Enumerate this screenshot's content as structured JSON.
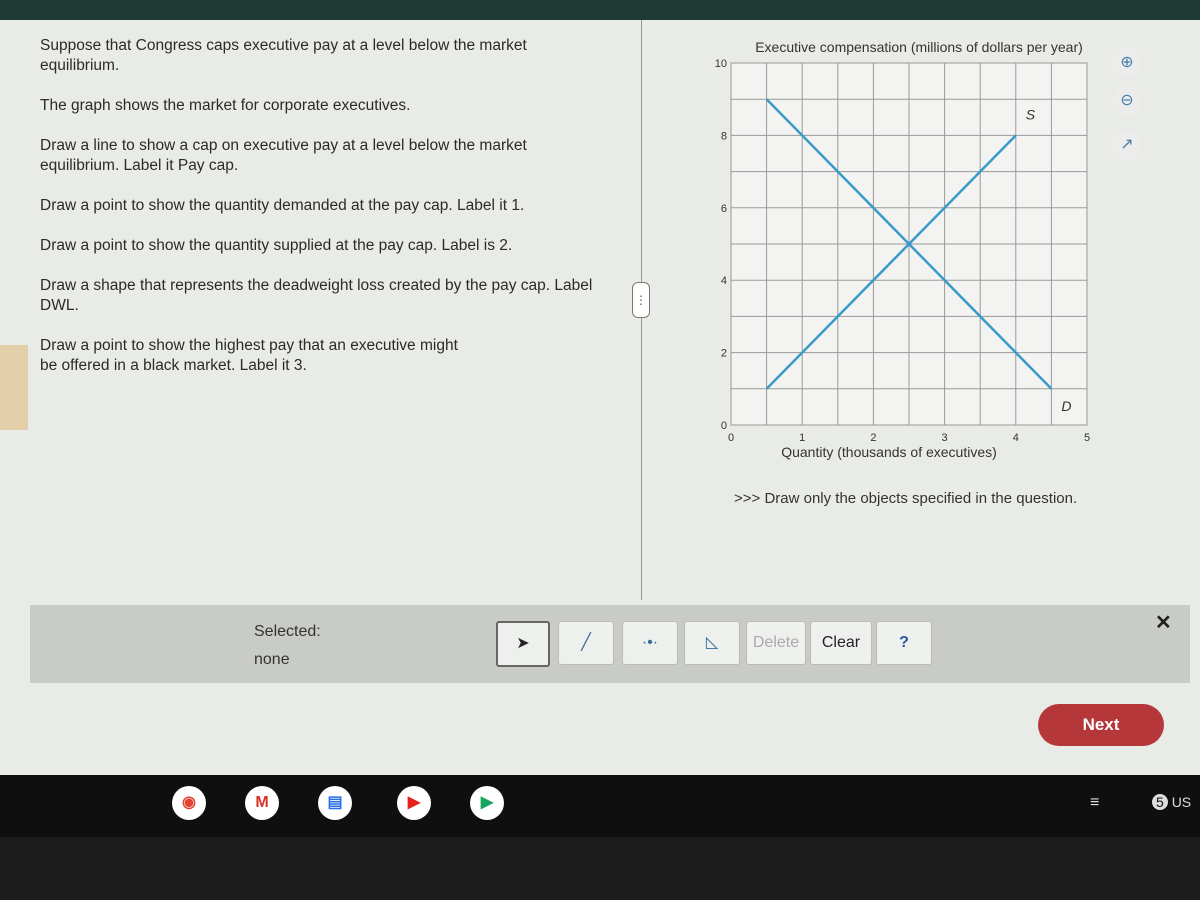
{
  "question": {
    "paragraphs": [
      "Suppose that Congress caps executive pay at a level below the market equilibrium.",
      "The graph shows the market for corporate executives.",
      "Draw a line to show a cap on executive pay at a level below the market equilibrium. Label it Pay cap.",
      "Draw a point to show the quantity demanded at the pay cap. Label it 1.",
      "Draw a point to show the quantity supplied at the pay cap. Label is 2.",
      "Draw a shape that represents the deadweight loss created by the pay cap. Label DWL.",
      "Draw a point to show the highest pay that an executive might be offered in a black market. Label it 3."
    ]
  },
  "graph_tools": {
    "zoom_in": "zoom-in-icon",
    "zoom_out": "zoom-out-icon",
    "popout": "popout-icon"
  },
  "chart_data": {
    "type": "line",
    "title": "Executive compensation (millions of dollars per year)",
    "xlabel": "Quantity (thousands of executives)",
    "ylabel": "Executive compensation (millions of dollars per year)",
    "xlim": [
      0,
      5
    ],
    "ylim": [
      0,
      10
    ],
    "xticks": [
      "0",
      "1",
      "2",
      "3",
      "4",
      "5"
    ],
    "yticks": [
      "0",
      "2",
      "4",
      "6",
      "8",
      "10"
    ],
    "grid": true,
    "series": [
      {
        "name": "S",
        "points": [
          [
            0.5,
            1
          ],
          [
            4,
            8
          ]
        ],
        "color": "#3a9ac9"
      },
      {
        "name": "D",
        "points": [
          [
            0.5,
            9
          ],
          [
            4.5,
            1
          ]
        ],
        "color": "#3a9ac9"
      }
    ]
  },
  "instruction": ">>> Draw only the objects specified in the question.",
  "toolbar": {
    "selected_label": "Selected:",
    "selected_value": "none",
    "delete": "Delete",
    "clear": "Clear",
    "help": "?"
  },
  "next": "Next",
  "shelf": {
    "notification_count": "5",
    "locale": "US"
  }
}
